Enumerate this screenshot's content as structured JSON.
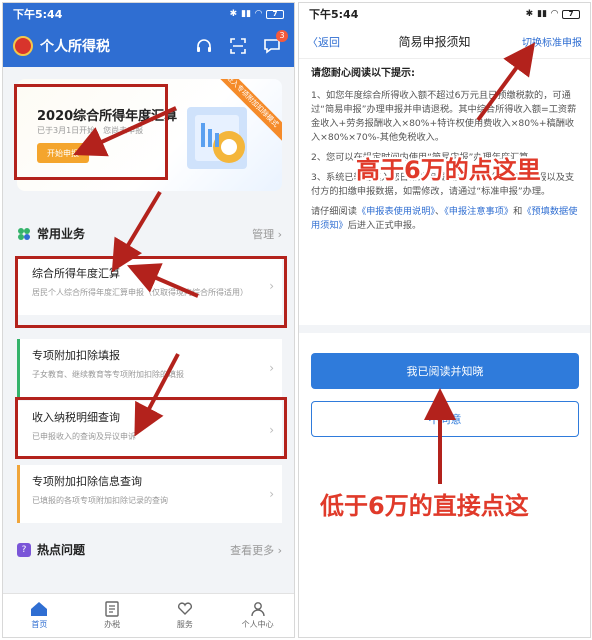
{
  "status_bar": {
    "time": "下午5:44",
    "battery": "7"
  },
  "left_app": {
    "title": "个人所得税",
    "message_badge": "3",
    "banner": {
      "title": "2020综合所得年度汇算",
      "subtitle": "已于3月1日开始，您尚未申报",
      "button": "开始申报",
      "ribbon": "进入专项附加扣除模式"
    },
    "common_section": {
      "title": "常用业务",
      "manage": "管理"
    },
    "cards": [
      {
        "title": "综合所得年度汇算",
        "subtitle": "居民个人综合所得年度汇算申报（仅取得境内综合所得适用）",
        "accent": "#2f6ed2"
      },
      {
        "title": "专项附加扣除填报",
        "subtitle": "子女教育、继续教育等专项附加扣除的填报",
        "accent": "#35b36b"
      },
      {
        "title": "收入纳税明细查询",
        "subtitle": "已申报收入的查询及异议申诉",
        "accent": "#2f6ed2"
      },
      {
        "title": "专项附加扣除信息查询",
        "subtitle": "已填报的各项专项附加扣除记录的查询",
        "accent": "#f0a53a"
      }
    ],
    "hot_section": {
      "title": "热点问题",
      "more": "查看更多"
    },
    "tabs": [
      {
        "label": "首页",
        "icon": "home-icon"
      },
      {
        "label": "办税",
        "icon": "document-icon"
      },
      {
        "label": "服务",
        "icon": "heart-hands-icon"
      },
      {
        "label": "个人中心",
        "icon": "person-icon"
      }
    ]
  },
  "right_app": {
    "nav": {
      "back": "返回",
      "title": "简易申报须知",
      "switch": "切换标准申报"
    },
    "notice_heading": "请您耐心阅读以下提示:",
    "para1_a": "1、如您年度综合所得收入额不超过6万元且已预缴税款的，可通过“简易申报”办理申报并申请退税。其中综合所得收入额=工资薪金收入+劳务报酬收入×80%+特许权使用费收入×80%+稿酬收入×80%×70%-其他免税收入。",
    "para2": "2、您可以在规定时间内使用“简易申报”办理年度汇算。",
    "para3": "3、系统已辅助填入您日常的申报数据，包括您的自行申报以及支付方的扣缴申报数据，如需修改，请通过“标准申报”办理。",
    "read_prefix": "请仔细阅读",
    "link1": "《申报表使用说明》",
    "sep": "、",
    "link2": "《申报注意事项》",
    "and": "和",
    "link3": "《预填数据使用须知》",
    "read_suffix": "后进入正式申报。",
    "btn_read": "我已阅读并知晓",
    "btn_disagree": "不同意"
  },
  "annotations": {
    "callout_high": "高于6万的点这里",
    "callout_low": "低于6万的直接点这"
  },
  "colors": {
    "primary": "#2f6ed2",
    "annotation": "#b3221c",
    "callout": "#e03a2a"
  }
}
